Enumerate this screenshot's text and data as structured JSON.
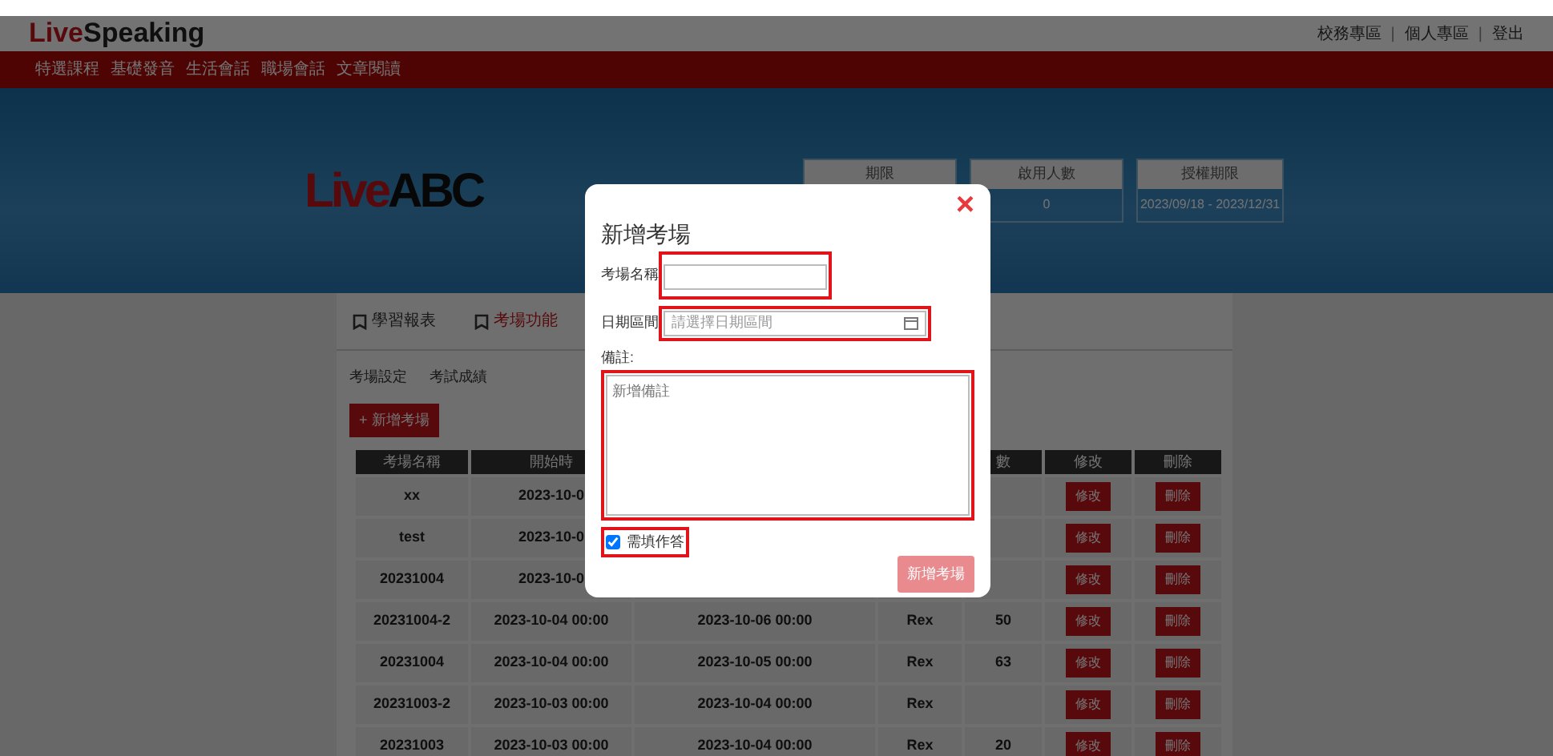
{
  "header": {
    "logo_part1": "Live",
    "logo_part2": "Speaking",
    "links": [
      {
        "kind": "link",
        "text": "校務專區"
      },
      {
        "kind": "separator",
        "text": "|"
      },
      {
        "kind": "link",
        "text": "個人專區"
      },
      {
        "kind": "separator",
        "text": "|"
      },
      {
        "kind": "link",
        "text": "登出"
      }
    ]
  },
  "nav": [
    "特選課程",
    "基礎發音",
    "生活會話",
    "職場會話",
    "文章閱讀"
  ],
  "banner": {
    "logo_part1": "Live",
    "logo_part2": "ABC",
    "info": [
      {
        "label": "期限"
      },
      {
        "label": "啟用人數",
        "value": "0"
      },
      {
        "label": "授權期限",
        "value": "2023/09/18 - 2023/12/31"
      }
    ]
  },
  "tabs": [
    {
      "label": "學習報表",
      "selected": false
    },
    {
      "label": "考場功能",
      "selected": true
    }
  ],
  "subtabs": [
    "考場設定",
    "考試成績"
  ],
  "add_button": "+ 新增考場",
  "table": {
    "columns": [
      "考場名稱",
      "開始時",
      null,
      null,
      "數",
      "修改",
      "刪除"
    ],
    "rows": [
      {
        "cells": [
          "xx",
          "2023-10-0"
        ],
        "edit": "修改",
        "delete": "刪除"
      },
      {
        "cells": [
          "test",
          "2023-10-0"
        ],
        "edit": "修改",
        "delete": "刪除"
      },
      {
        "cells": [
          "20231004",
          "2023-10-0"
        ],
        "edit": "修改",
        "delete": "刪除"
      },
      {
        "cells": [
          "20231004-2",
          "2023-10-04 00:00",
          "2023-10-06 00:00",
          "Rex",
          "50"
        ],
        "edit": "修改",
        "delete": "刪除"
      },
      {
        "cells": [
          "20231004",
          "2023-10-04 00:00",
          "2023-10-05 00:00",
          "Rex",
          "63"
        ],
        "edit": "修改",
        "delete": "刪除"
      },
      {
        "cells": [
          "20231003-2",
          "2023-10-03 00:00",
          "2023-10-04 00:00",
          "Rex",
          null
        ],
        "edit": "修改",
        "delete": "刪除"
      },
      {
        "cells": [
          "20231003",
          "2023-10-03 00:00",
          "2023-10-04 00:00",
          "Rex",
          "20"
        ],
        "edit": "修改",
        "delete": "刪除"
      }
    ]
  },
  "modal": {
    "close": "×",
    "title": "新增考場",
    "name_label": "考場名稱",
    "date_label": "日期區間",
    "date_placeholder": "請選擇日期區間",
    "note_label": "備註:",
    "note_placeholder": "新增備註",
    "checkbox": {
      "label": "需填作答",
      "checked": true
    },
    "submit": "新增考場"
  }
}
